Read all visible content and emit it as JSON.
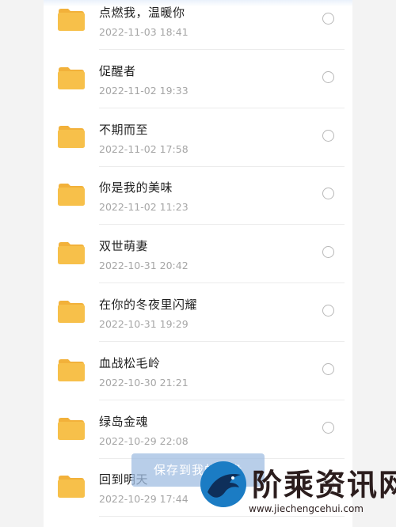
{
  "colors": {
    "folder": "#f7c04a",
    "folder_tab": "#f2b13a",
    "date_text": "#a6a6a6",
    "save_button_bg": "#a0bee1",
    "watermark_blue": "#1b7cc4"
  },
  "files": [
    {
      "name": "点燃我，温暖你",
      "date": "2022-11-03 18:41",
      "icon": "folder-icon"
    },
    {
      "name": "促醒者",
      "date": "2022-11-02 19:33",
      "icon": "folder-icon"
    },
    {
      "name": "不期而至",
      "date": "2022-11-02 17:58",
      "icon": "folder-icon"
    },
    {
      "name": "你是我的美味",
      "date": "2022-11-02 11:23",
      "icon": "folder-icon"
    },
    {
      "name": "双世萌妻",
      "date": "2022-10-31 20:42",
      "icon": "folder-icon"
    },
    {
      "name": "在你的冬夜里闪耀",
      "date": "2022-10-31 19:29",
      "icon": "folder-icon"
    },
    {
      "name": "血战松毛岭",
      "date": "2022-10-30 21:21",
      "icon": "folder-icon"
    },
    {
      "name": "绿岛金魂",
      "date": "2022-10-29 22:08",
      "icon": "folder-icon"
    },
    {
      "name": "回到明天",
      "date": "2022-10-29 17:44",
      "icon": "folder-icon"
    }
  ],
  "save_button": {
    "label": "保存到我的云盘"
  },
  "watermark": {
    "title": "阶乘资讯网",
    "url": "www.jiechengcehui.com"
  }
}
